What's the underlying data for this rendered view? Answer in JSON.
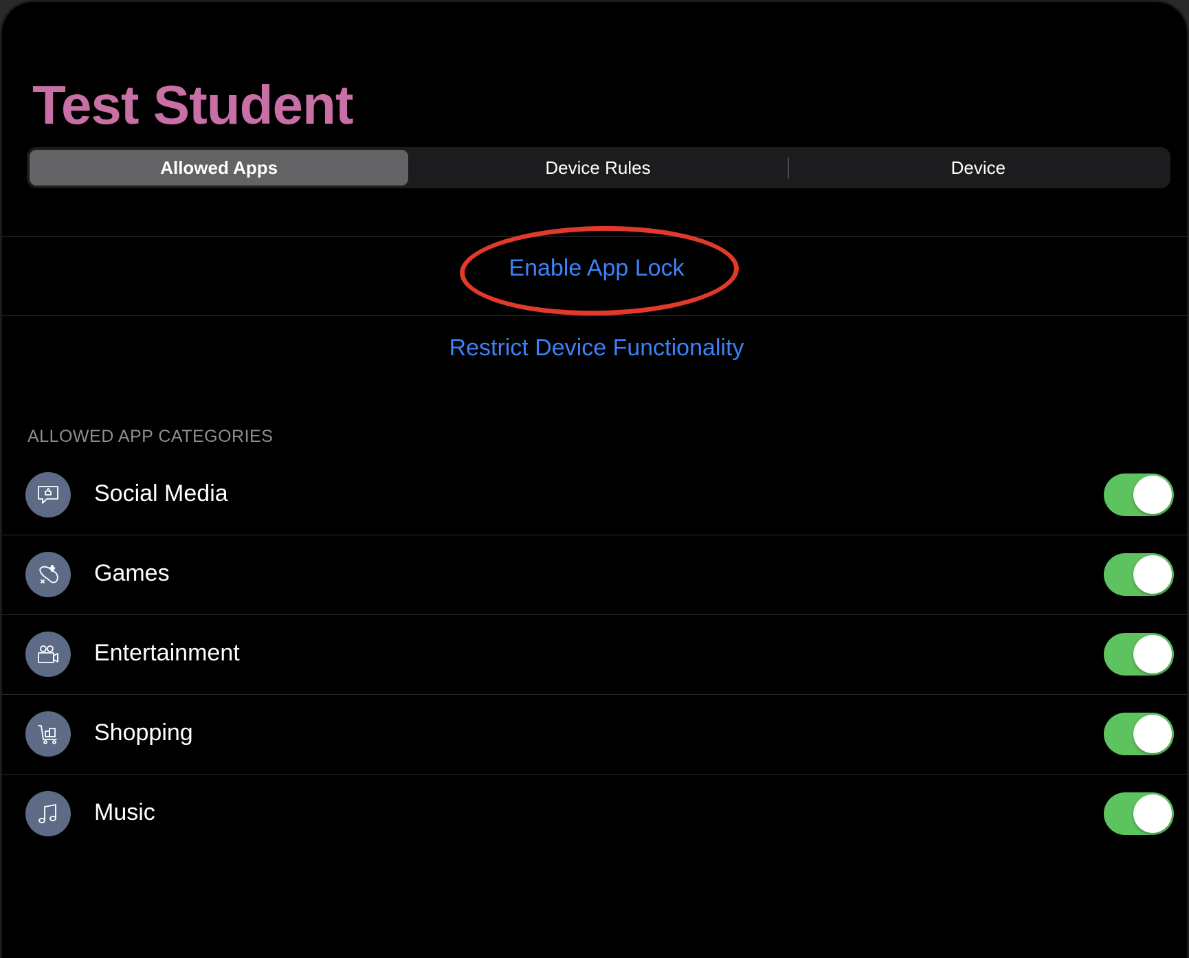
{
  "header": {
    "title": "Test Student"
  },
  "tabs": [
    {
      "label": "Allowed Apps",
      "selected": true
    },
    {
      "label": "Device Rules",
      "selected": false
    },
    {
      "label": "Device",
      "selected": false
    }
  ],
  "actions": {
    "enable_app_lock": "Enable App Lock",
    "restrict_device": "Restrict Device Functionality"
  },
  "categories": {
    "header": "ALLOWED APP CATEGORIES",
    "items": [
      {
        "label": "Social Media",
        "icon": "social-media-icon",
        "enabled": true
      },
      {
        "label": "Games",
        "icon": "games-icon",
        "enabled": true
      },
      {
        "label": "Entertainment",
        "icon": "entertainment-icon",
        "enabled": true
      },
      {
        "label": "Shopping",
        "icon": "shopping-icon",
        "enabled": true
      },
      {
        "label": "Music",
        "icon": "music-icon",
        "enabled": true
      }
    ]
  },
  "colors": {
    "title": "#c86fa5",
    "link": "#3b82f6",
    "toggle_on": "#5dc35f",
    "icon_bg": "#5e6b87",
    "annotation": "#e13a2b"
  }
}
